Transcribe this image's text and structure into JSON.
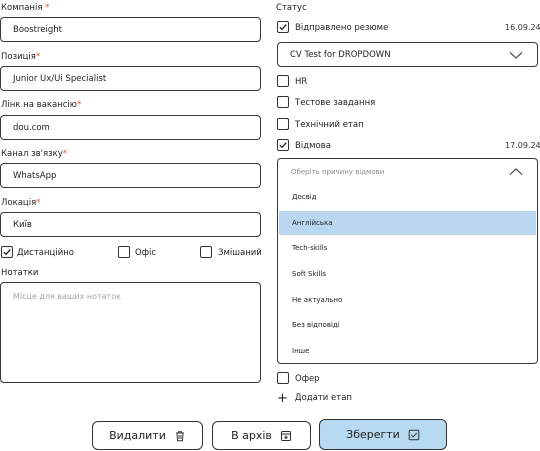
{
  "left": {
    "company": {
      "label": "Компанія",
      "required_mark": " *",
      "value": "Boostreight"
    },
    "position": {
      "label": "Позиція",
      "required_mark": "*",
      "value": "Junior Ux/Ui Specialist"
    },
    "vacancy_link": {
      "label": "Лінк на вакансію",
      "required_mark": "*",
      "value": "dou.com"
    },
    "channel": {
      "label": "Канал зв'язку",
      "required_mark": "*",
      "value": "WhatsApp"
    },
    "location": {
      "label": "Локація",
      "required_mark": "*",
      "value": "Київ"
    },
    "work_modes": [
      {
        "label": "Дистанційно",
        "checked": true
      },
      {
        "label": "Офіс",
        "checked": false
      },
      {
        "label": "Змішаний",
        "checked": false
      }
    ],
    "notes": {
      "label": "Нотатки",
      "placeholder": "Місце для ваших нотаток"
    }
  },
  "right": {
    "status_label": "Статус",
    "stages": {
      "resume_sent": {
        "label": "Відправлено резюме",
        "checked": true,
        "date": "16.09.24"
      },
      "cv_select": {
        "value": "CV Test for DROPDOWN"
      },
      "hr": {
        "label": "HR",
        "checked": false
      },
      "test_task": {
        "label": "Тестове завдання",
        "checked": false
      },
      "tech_stage": {
        "label": "Технічний етап",
        "checked": false
      },
      "rejection": {
        "label": "Відмова",
        "checked": true,
        "date": "17.09.24"
      },
      "offer": {
        "label": "Офер",
        "checked": false
      }
    },
    "rejection_dropdown": {
      "placeholder": "Оберіть причину відмови",
      "options": [
        "Досвід",
        "Англійська",
        "Tech-skills",
        "Soft Skills",
        "Не актуально",
        "Без відповіді",
        "Інше"
      ],
      "highlighted_index": 1
    },
    "add_stage": {
      "icon": "+",
      "label": "Додати етап"
    }
  },
  "actions": {
    "delete_label": "Видалити",
    "archive_label": "В архів",
    "save_label": "Зберегти"
  },
  "colors": {
    "primary": "#b8d9f2",
    "highlight": "#b9d8ef",
    "required": "#e0503f"
  }
}
